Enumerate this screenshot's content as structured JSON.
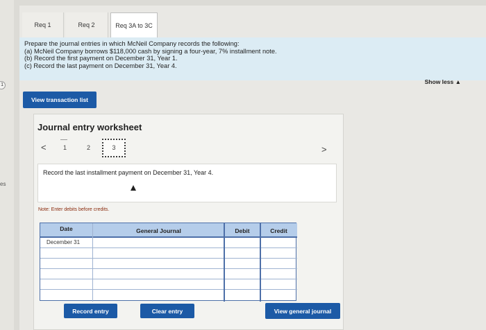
{
  "side": {
    "page_marker": "1",
    "side_text": "es"
  },
  "tabs": [
    {
      "label": "Req 1"
    },
    {
      "label": "Req 2"
    },
    {
      "label": "Req 3A to 3C"
    }
  ],
  "instructions": {
    "line1": "Prepare the journal entries in which McNeil Company records the following:",
    "line2": "(a) McNeil Company borrows $118,000 cash by signing a four-year, 7% installment note.",
    "line3": "(b) Record the first payment on December 31, Year 1.",
    "line4": "(c) Record the last payment on December 31, Year 4."
  },
  "show_less_label": "Show less ▲",
  "view_transaction_list_label": "View transaction list",
  "worksheet": {
    "title": "Journal entry worksheet",
    "pager": {
      "prev": "<",
      "next": ">",
      "pages": [
        "1",
        "2",
        "3"
      ],
      "current": "3"
    },
    "record_text": "Record the last installment payment on December 31, Year 4.",
    "note": "Note: Enter debits before credits."
  },
  "journal": {
    "headers": {
      "date": "Date",
      "general_journal": "General Journal",
      "debit": "Debit",
      "credit": "Credit"
    },
    "rows": [
      {
        "date": "December 31"
      },
      {
        "date": ""
      },
      {
        "date": ""
      },
      {
        "date": ""
      },
      {
        "date": ""
      },
      {
        "date": ""
      }
    ]
  },
  "buttons": {
    "record_entry": "Record entry",
    "clear_entry": "Clear entry",
    "view_general_journal": "View general journal"
  }
}
